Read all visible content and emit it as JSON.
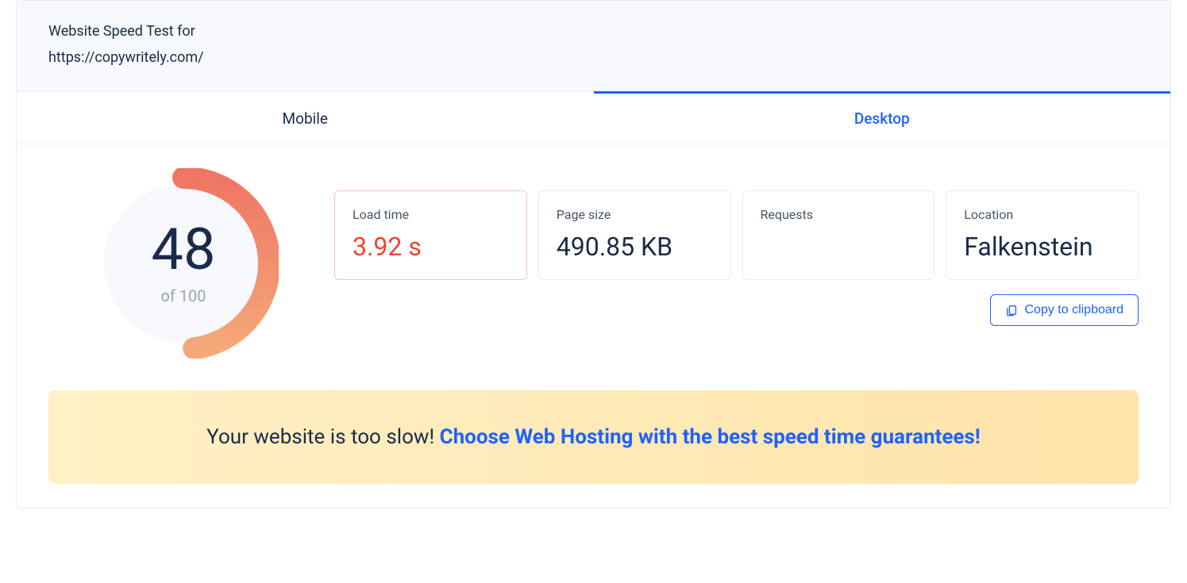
{
  "header": {
    "title": "Website Speed Test for",
    "url": "https://copywritely.com/"
  },
  "tabs": [
    {
      "label": "Mobile",
      "active": false
    },
    {
      "label": "Desktop",
      "active": true
    }
  ],
  "score": {
    "value": "48",
    "outOf": "of 100",
    "percent": 48
  },
  "stats": {
    "loadTime": {
      "label": "Load time",
      "value": "3.92 s"
    },
    "pageSize": {
      "label": "Page size",
      "value": "490.85 KB"
    },
    "requests": {
      "label": "Requests",
      "value": ""
    },
    "location": {
      "label": "Location",
      "value": "Falkenstein"
    }
  },
  "copyButton": {
    "label": "Copy to clipboard"
  },
  "banner": {
    "intro": "Your website is too slow! ",
    "cta": "Choose Web Hosting with the best speed time guarantees!"
  },
  "colors": {
    "link": "#1d62ff",
    "warn": "#e9462f",
    "arcStart": "#f4a97a",
    "arcEnd": "#ef7664"
  }
}
